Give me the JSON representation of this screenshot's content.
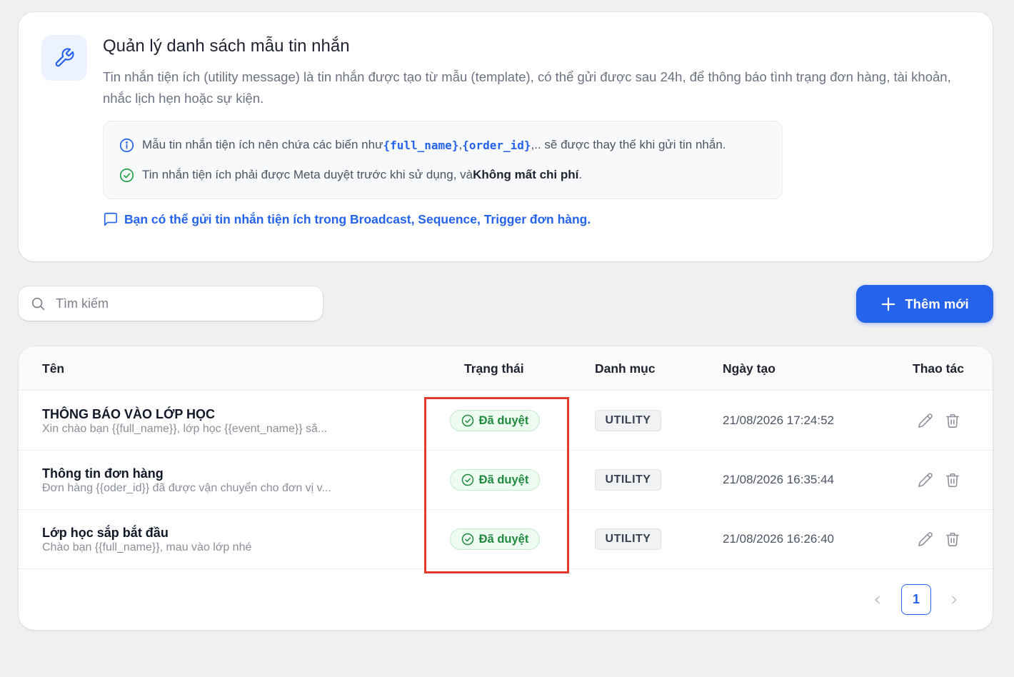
{
  "info": {
    "title": "Quản lý danh sách mẫu tin nhắn",
    "description": "Tin nhắn tiện ích (utility message) là tin nhắn được tạo từ mẫu (template), có thể gửi được sau 24h, để thông báo tình trạng đơn hàng, tài khoản, nhắc lịch hẹn hoặc sự kiện.",
    "note1": {
      "prefix": "Mẫu tin nhắn tiện ích nên chứa các biến như ",
      "var1": "{full_name}",
      "sep": ", ",
      "var2": "{order_id}",
      "suffix": ",.. sẽ được thay thế khi gửi tin nhắn."
    },
    "note2": {
      "prefix": "Tin nhắn tiện ích phải được Meta duyệt trước khi sử dụng, và ",
      "bold": "Không mất chi phí",
      "suffix": "."
    },
    "promo": "Bạn có thể gửi tin nhắn tiện ích trong Broadcast, Sequence, Trigger đơn hàng."
  },
  "search": {
    "placeholder": "Tìm kiếm"
  },
  "add_button": {
    "label": "Thêm mới"
  },
  "table": {
    "headers": {
      "name": "Tên",
      "status": "Trạng thái",
      "category": "Danh mục",
      "created": "Ngày tạo",
      "actions": "Thao tác"
    },
    "rows": [
      {
        "name": "THÔNG BÁO VÀO LỚP HỌC",
        "preview": "Xin chào bạn {{full_name}}, lớp học {{event_name}} sắ...",
        "status": "Đã duyệt",
        "category": "UTILITY",
        "created": "21/08/2026 17:24:52"
      },
      {
        "name": "Thông tin đơn hàng",
        "preview": "Đơn hàng {{oder_id}} đã được vận chuyển cho đơn vị v...",
        "status": "Đã duyệt",
        "category": "UTILITY",
        "created": "21/08/2026 16:35:44"
      },
      {
        "name": "Lớp học sắp bắt đầu",
        "preview": "Chào bạn {{full_name}}, mau vào lớp nhé",
        "status": "Đã duyệt",
        "category": "UTILITY",
        "created": "21/08/2026 16:26:40"
      }
    ]
  },
  "pagination": {
    "current": "1"
  },
  "colors": {
    "accent": "#2563eb",
    "approved": "#1f8a3d",
    "highlight": "#e23b2e",
    "background": "#f0f0f0"
  },
  "icons": {
    "header": "wrench-icon",
    "note1": "info-icon",
    "note2": "check-circle-icon",
    "promo": "message-square-icon",
    "search": "search-icon",
    "add": "plus-icon",
    "edit": "pencil-icon",
    "delete": "trash-icon",
    "prev": "chevron-left-icon",
    "next": "chevron-right-icon"
  }
}
